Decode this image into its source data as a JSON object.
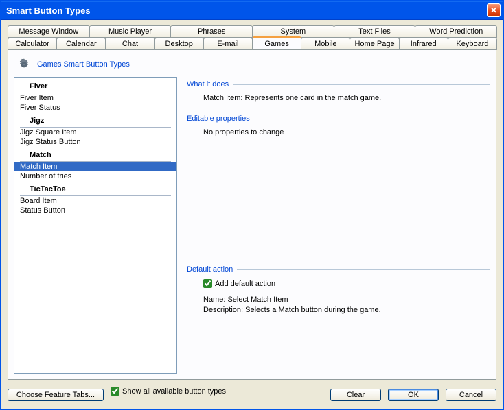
{
  "window": {
    "title": "Smart Button Types"
  },
  "tabs": {
    "row1": [
      "Message Window",
      "Music Player",
      "Phrases",
      "System",
      "Text Files",
      "Word Prediction"
    ],
    "row2": [
      "Calculator",
      "Calendar",
      "Chat",
      "Desktop",
      "E-mail",
      "Games",
      "Mobile",
      "Home Page",
      "Infrared",
      "Keyboard"
    ],
    "active": "Games"
  },
  "heading": "Games Smart Button Types",
  "list": {
    "categories": [
      {
        "name": "Fiver",
        "items": [
          "Fiver Item",
          "Fiver Status"
        ]
      },
      {
        "name": "Jigz",
        "items": [
          "Jigz Square Item",
          "Jigz Status Button"
        ]
      },
      {
        "name": "Match",
        "items": [
          "Match Item",
          "Number of tries"
        ]
      },
      {
        "name": "TicTacToe",
        "items": [
          "Board Item",
          "Status Button"
        ]
      }
    ],
    "selected": "Match Item"
  },
  "detail": {
    "what_label": "What it does",
    "what_text": "Match Item: Represents one card in the match game.",
    "editable_label": "Editable properties",
    "editable_text": "No properties to change",
    "default_label": "Default action",
    "add_default_checkbox": "Add default action",
    "add_default_checked": true,
    "name_label": "Name:",
    "name_value": "Select Match Item",
    "desc_label": "Description:",
    "desc_value": "Selects a Match button during the game."
  },
  "footer": {
    "choose": "Choose Feature Tabs...",
    "show_all": "Show all available button types",
    "show_all_checked": true,
    "clear": "Clear",
    "ok": "OK",
    "cancel": "Cancel"
  }
}
